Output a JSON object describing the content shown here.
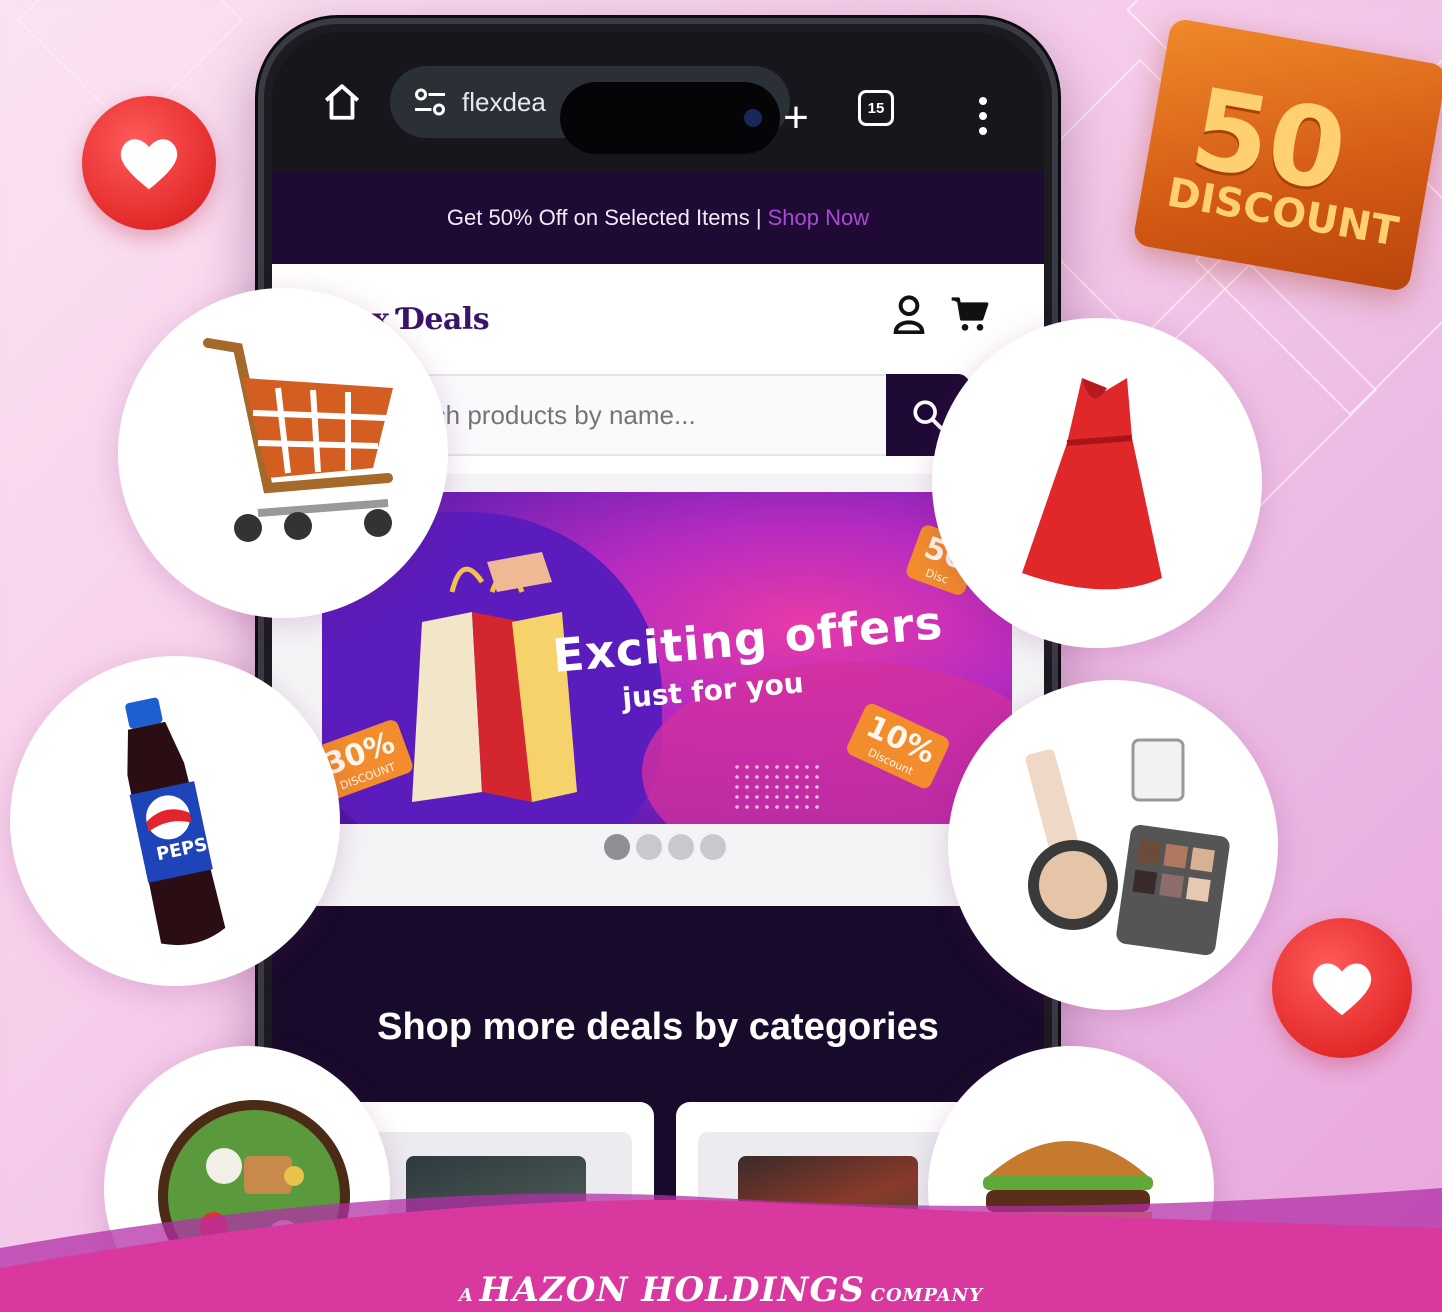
{
  "browser": {
    "url_text": "flexdea",
    "tab_count": "15"
  },
  "promo": {
    "text": "Get 50% Off on Selected Items |",
    "cta": "Shop Now"
  },
  "header": {
    "logo_text": "lex Ɗeals"
  },
  "search": {
    "placeholder": "rch products by name..."
  },
  "banner": {
    "title": "Exciting offers",
    "subtitle": "just for you",
    "tag_left": "30%",
    "tag_left_small": "DISCOUNT",
    "tag_right": "10%",
    "tag_right_small": "Discount",
    "tag_top": "50",
    "tag_top_small": "Disc",
    "slide_count": 4,
    "active_slide": 1
  },
  "categories": {
    "title": "Shop more deals by categories"
  },
  "discount_badge": {
    "value": "50",
    "label": "DISCOUNT"
  },
  "footer": {
    "prefix": "A",
    "company": "HAZON HOLDINGS",
    "suffix": "COMPANY"
  },
  "colors": {
    "brand_dark": "#1e0a35",
    "accent_purple": "#a94ad4",
    "footer_magenta": "#d9399f"
  },
  "icons": {
    "home": "home-icon",
    "tune": "tune-icon",
    "new_tab": "plus-icon",
    "tabs": "tab-count-icon",
    "menu": "kebab-menu-icon",
    "user": "user-icon",
    "cart": "cart-icon",
    "search": "search-icon",
    "heart": "heart-icon"
  }
}
